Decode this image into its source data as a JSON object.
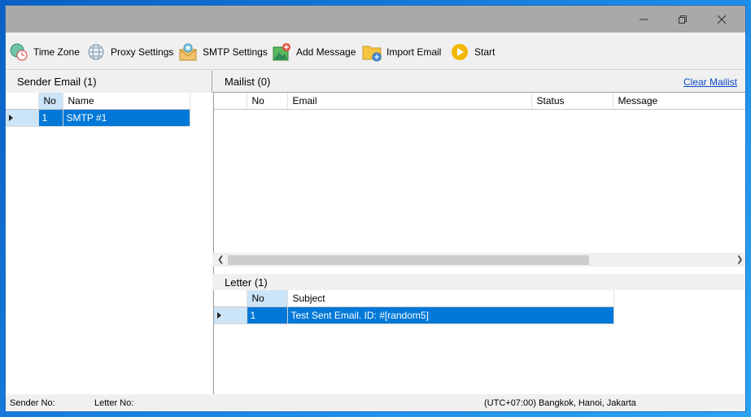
{
  "window": {
    "controls": [
      "minimize",
      "restore",
      "close"
    ]
  },
  "toolbar": {
    "items": [
      {
        "label": "Time Zone",
        "icon": "time-zone-icon"
      },
      {
        "label": "Proxy Settings",
        "icon": "globe-icon"
      },
      {
        "label": "SMTP Settings",
        "icon": "mail-settings-icon"
      },
      {
        "label": "Add Message",
        "icon": "add-message-icon"
      },
      {
        "label": "Import Email",
        "icon": "folder-import-icon"
      },
      {
        "label": "Start",
        "icon": "play-icon"
      }
    ]
  },
  "sender": {
    "title": "Sender Email (1)",
    "columns": [
      "No",
      "Name"
    ],
    "rows": [
      {
        "no": "1",
        "name": "SMTP #1"
      }
    ]
  },
  "mailist": {
    "title": "Mailist (0)",
    "clear_label": "Clear Mailist",
    "columns": [
      "No",
      "Email",
      "Status",
      "Message"
    ],
    "rows": []
  },
  "letter": {
    "title": "Letter (1)",
    "columns": [
      "No",
      "Subject"
    ],
    "rows": [
      {
        "no": "1",
        "subject": "Test Sent Email. ID: #[random5]"
      }
    ]
  },
  "status": {
    "sender_no": "Sender No:",
    "letter_no": "Letter No:",
    "timezone": "(UTC+07:00) Bangkok, Hanoi, Jakarta"
  },
  "colors": {
    "selection": "#0078d7",
    "header_selected": "#cce4f7",
    "titlebar": "#a9a9a9",
    "link": "#0b49c9"
  }
}
